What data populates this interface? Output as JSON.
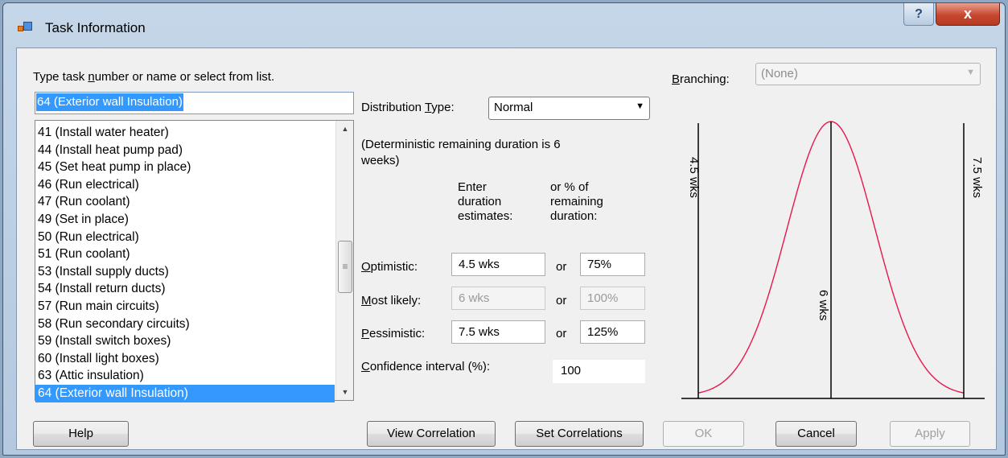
{
  "window": {
    "title": "Task Information",
    "help_glyph": "?",
    "close_glyph": "x"
  },
  "task_panel": {
    "prompt_pre": "Type task ",
    "prompt_key": "n",
    "prompt_post": "umber or name or select from  list.",
    "input_value": "64 (Exterior wall Insulation)",
    "items": [
      "41 (Install water heater)",
      "44 (Install heat pump pad)",
      "45 (Set heat pump in place)",
      "46 (Run electrical)",
      "47 (Run coolant)",
      "49 (Set in place)",
      "50 (Run electrical)",
      "51 (Run coolant)",
      "53 (Install supply ducts)",
      "54 (Install return ducts)",
      "57 (Run main circuits)",
      "58 (Run secondary circuits)",
      "59 (Install switch boxes)",
      "60 (Install light boxes)",
      "63 (Attic insulation)",
      "64 (Exterior wall Insulation)"
    ],
    "selected_index": 15
  },
  "distribution": {
    "label_pre": "Distribution ",
    "label_key": "T",
    "label_post": "ype:",
    "value": "Normal",
    "note_line1": "(Deterministic remaining  duration is 6",
    "note_line2": "weeks)",
    "col1_line1": "Enter",
    "col1_line2": "duration",
    "col1_line3": "estimates:",
    "col2_line1": "or %  of",
    "col2_line2": "remaining",
    "col2_line3": "duration:",
    "optimistic": {
      "key": "O",
      "rest": "ptimistic:",
      "duration": "4.5 wks",
      "or": "or",
      "pct": "75%"
    },
    "most_likely": {
      "key": "M",
      "rest": "ost likely:",
      "duration": "6 wks",
      "or": "or",
      "pct": "100%"
    },
    "pessimistic": {
      "key": "P",
      "rest": "essimistic:",
      "duration": "7.5 wks",
      "or": "or",
      "pct": "125%"
    },
    "confidence": {
      "key": "C",
      "rest": "onfidence interval (%):",
      "value": "100"
    }
  },
  "branching": {
    "label_key": "B",
    "label_rest": "ranching:",
    "value": "(None)"
  },
  "chart_data": {
    "type": "line",
    "curve": "normal distribution",
    "markers": [
      {
        "label": "4.5 wks",
        "x": 4.5
      },
      {
        "label": "6 wks",
        "x": 6
      },
      {
        "label": "7.5 wks",
        "x": 7.5
      }
    ],
    "xlim": [
      4.5,
      7.5
    ],
    "line_color": "#e8174b"
  },
  "buttons": {
    "help": "Help",
    "view_correlation": "View Correlation",
    "set_correlations": "Set Correlations",
    "ok": "OK",
    "cancel": "Cancel",
    "apply": "Apply"
  }
}
